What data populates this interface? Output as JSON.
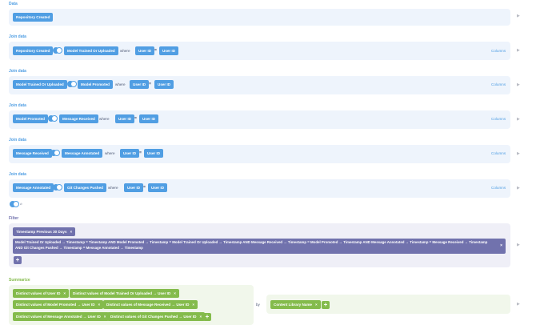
{
  "data_step": {
    "title": "Data",
    "source": "Repository Created"
  },
  "joins": [
    {
      "title": "Join data",
      "left": "Repository Created",
      "right": "Model Trained Or Uploaded",
      "where": "where",
      "lhs": "User ID",
      "op": "=",
      "rhs": "User ID",
      "columns": "Columns"
    },
    {
      "title": "Join data",
      "left": "Model Trained Or Uploaded",
      "right": "Model Promoted",
      "where": "where",
      "lhs": "User ID",
      "op": "=",
      "rhs": "User ID",
      "columns": "Columns"
    },
    {
      "title": "Join data",
      "left": "Model Promoted",
      "right": "Message Received",
      "where": "where",
      "lhs": "User ID",
      "op": "=",
      "rhs": "User ID",
      "columns": "Columns"
    },
    {
      "title": "Join data",
      "left": "Message Received",
      "right": "Message Annotated",
      "where": "where",
      "lhs": "User ID",
      "op": "=",
      "rhs": "User ID",
      "columns": "Columns"
    },
    {
      "title": "Join data",
      "left": "Message Annotated",
      "right": "Git Changes Pushed",
      "where": "where",
      "lhs": "User ID",
      "op": "=",
      "rhs": "User ID",
      "columns": "Columns"
    }
  ],
  "filter": {
    "title": "Filter",
    "chip": "Timestamp Previous 30 Days",
    "expression": "Model Trained Or Uploaded → Timestamp = Timestamp AND Model Promoted → Timestamp = Model Trained Or Uploaded → Timestamp AND Message Received → Timestamp = Model Promoted → Timestamp AND Message Annotated → Timestamp = Message Received → Timestamp AND Git Changes Pushed → Timestamp = Message Annotated → Timestamp",
    "add": "+"
  },
  "summarize": {
    "title": "Summarize",
    "metrics": [
      "Distinct values of User ID",
      "Distinct values of Model Trained Or Uploaded → User ID",
      "Distinct values of Model Promoted → User ID",
      "Distinct values of Message Received → User ID",
      "Distinct values of Message Annotated → User ID",
      "Distinct values of Git Changes Pushed → User ID"
    ],
    "by": "by",
    "group": "Content Library Name",
    "add": "+"
  },
  "icons": {
    "remove": "×",
    "arrow": "▶",
    "extra": "⌀"
  },
  "colors": {
    "data": "#509ee3",
    "filter": "#7172ad",
    "summarize": "#84bb4c"
  }
}
